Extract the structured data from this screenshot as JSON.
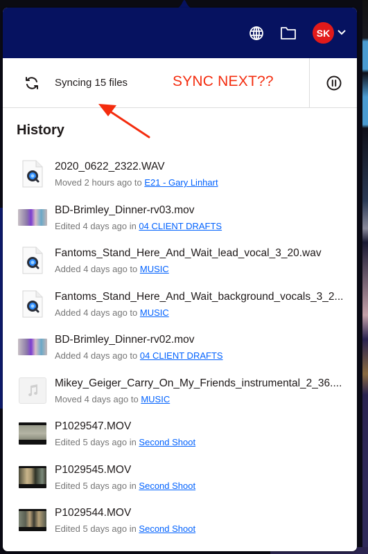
{
  "header": {
    "globe_icon": "globe-icon",
    "folder_icon": "folder-icon",
    "avatar_initials": "SK",
    "avatar_color": "#e21a1a",
    "background_color": "#061260"
  },
  "sync": {
    "status_text": "Syncing 15 files",
    "annotation": "SYNC NEXT??",
    "annotation_color": "#f42c0e",
    "pause_icon": "pause-circle-icon"
  },
  "history": {
    "title": "History",
    "items": [
      {
        "name": "2020_0622_2322.WAV",
        "action": "Moved 2 hours ago to ",
        "folder": "E21 - Gary Linhart",
        "thumb": "quicktime"
      },
      {
        "name": "BD-Brimley_Dinner-rv03.mov",
        "action": "Edited 4 days ago in ",
        "folder": "04 CLIENT DRAFTS",
        "thumb": "video-colorful"
      },
      {
        "name": "Fantoms_Stand_Here_And_Wait_lead_vocal_3_20.wav",
        "action": "Added 4 days ago to ",
        "folder": "MUSIC",
        "thumb": "quicktime"
      },
      {
        "name": "Fantoms_Stand_Here_And_Wait_background_vocals_3_2...",
        "action": "Added 4 days ago to ",
        "folder": "MUSIC",
        "thumb": "quicktime"
      },
      {
        "name": "BD-Brimley_Dinner-rv02.mov",
        "action": "Added 4 days ago to ",
        "folder": "04 CLIENT DRAFTS",
        "thumb": "video-colorful"
      },
      {
        "name": "Mikey_Geiger_Carry_On_My_Friends_instrumental_2_36....",
        "action": "Moved 4 days ago to ",
        "folder": "MUSIC",
        "thumb": "music"
      },
      {
        "name": "P1029547.MOV",
        "action": "Edited 5 days ago in ",
        "folder": "Second Shoot",
        "thumb": "video-gray"
      },
      {
        "name": "P1029545.MOV",
        "action": "Edited 5 days ago in ",
        "folder": "Second Shoot",
        "thumb": "video-dark"
      },
      {
        "name": "P1029544.MOV",
        "action": "Edited 5 days ago in ",
        "folder": "Second Shoot",
        "thumb": "video-dark2"
      }
    ]
  }
}
